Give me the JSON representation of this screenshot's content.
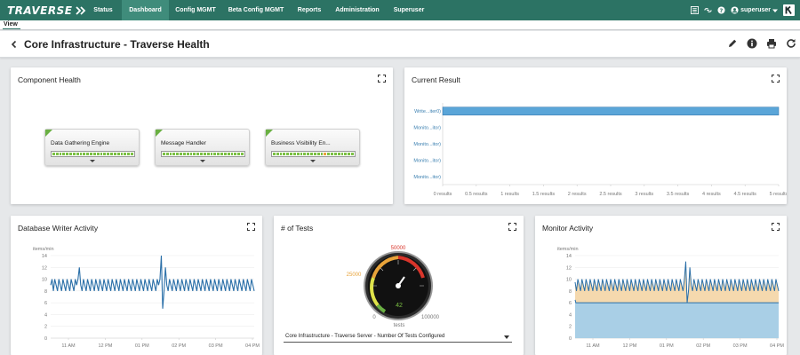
{
  "nav": {
    "brand": "TRAVERSE",
    "tabs": [
      "Status",
      "Dashboard",
      "Config MGMT",
      "Beta Config MGMT",
      "Reports",
      "Administration",
      "Superuser"
    ],
    "active_tab": "Dashboard",
    "user": "superuser"
  },
  "view_label": "View",
  "page": {
    "title": "Core Infrastructure - Traverse Health"
  },
  "component_health": {
    "title": "Component Health",
    "components": [
      {
        "name": "Data Gathering Engine",
        "health": "green"
      },
      {
        "name": "Message Handler",
        "health": "green"
      },
      {
        "name": "Business Visibility En...",
        "health": "green-with-warning"
      }
    ]
  },
  "current_result": {
    "title": "Current Result",
    "rows": [
      "Write...iter0)",
      "Monito...itor)",
      "Monito...itor)",
      "Monito...itor)",
      "Monito...itor)"
    ],
    "x_ticks": [
      "0 results",
      "0.5 results",
      "1 results",
      "1.5 results",
      "2 results",
      "2.5 results",
      "3 results",
      "3.5 results",
      "4 results",
      "4.5 results",
      "5 results"
    ]
  },
  "db_writer": {
    "title": "Database Writer Activity",
    "unit": "items/min"
  },
  "num_tests": {
    "title": "# of Tests",
    "gauge_max": "50000",
    "gauge_mid": "25000",
    "gauge_min": "0",
    "gauge_top": "100000",
    "value": "42",
    "unit": "tests",
    "selector": "Core Infrastructure - Traverse Server - Number Of Tests Configured"
  },
  "monitor_activity": {
    "title": "Monitor Activity",
    "unit": "items/min"
  },
  "chart_data": [
    {
      "type": "bar",
      "title": "Current Result",
      "categories": [
        "Write...iter0)",
        "Monito...itor)",
        "Monito...itor)",
        "Monito...itor)",
        "Monito...itor)"
      ],
      "values": [
        5,
        0,
        0,
        0,
        0
      ],
      "xlim": [
        0,
        5
      ],
      "orientation": "horizontal",
      "color": "#5aa5d8"
    },
    {
      "type": "line",
      "title": "Database Writer Activity",
      "ylabel": "items/min",
      "ylim": [
        0,
        14
      ],
      "yticks": [
        "0",
        "2",
        "4",
        "6",
        "8",
        "10",
        "12",
        "14"
      ],
      "xticks": [
        "11 AM",
        "12 PM",
        "01 PM",
        "02 PM",
        "03 PM",
        "04 PM"
      ],
      "series": [
        {
          "values": [
            9,
            10,
            8,
            10,
            9,
            8,
            10,
            9,
            8,
            10,
            9,
            8,
            10,
            9,
            8,
            10,
            9,
            8,
            10,
            9,
            10,
            12,
            9,
            8,
            10,
            9,
            8,
            10,
            9,
            8,
            10,
            9,
            8,
            10,
            9,
            8,
            10,
            9,
            8,
            10,
            9,
            8,
            10,
            9,
            8,
            10,
            9,
            8,
            10,
            9,
            8,
            10,
            9,
            8,
            10,
            9,
            8,
            10,
            9,
            8,
            10,
            9,
            8,
            10,
            9,
            8,
            10,
            9,
            8,
            10,
            9,
            8,
            10,
            9,
            8,
            10,
            9,
            8,
            10,
            9,
            10,
            14,
            5,
            8,
            12,
            9,
            8,
            10,
            9,
            8,
            10,
            9,
            8,
            10,
            9,
            8,
            10,
            9,
            8,
            10,
            9,
            8,
            10,
            9,
            8,
            10,
            9,
            8,
            10,
            9,
            8,
            10,
            9,
            8,
            10,
            9,
            8,
            10,
            9,
            8,
            10,
            9,
            8,
            10,
            9,
            8,
            10,
            9,
            8,
            10,
            9,
            8,
            10,
            9,
            8,
            10,
            9,
            8,
            10,
            9,
            8,
            10,
            9,
            8,
            10,
            9,
            8,
            10,
            9,
            8
          ]
        }
      ],
      "color": "#2a6fa8"
    },
    {
      "type": "area",
      "title": "Monitor Activity",
      "ylabel": "items/min",
      "ylim": [
        0,
        14
      ],
      "yticks": [
        "0",
        "2",
        "4",
        "6",
        "8",
        "10",
        "12",
        "14"
      ],
      "xticks": [
        "11 AM",
        "12 PM",
        "01 PM",
        "02 PM",
        "03 PM",
        "04 PM"
      ],
      "series": [
        {
          "values": [
            6.5,
            6,
            6,
            6,
            6,
            6,
            6,
            6,
            6,
            6,
            6,
            6,
            6,
            6,
            6,
            6,
            6,
            6,
            6,
            6,
            6,
            6,
            6,
            6,
            6,
            6,
            6,
            6,
            6,
            6,
            6,
            6,
            6,
            6,
            6,
            6,
            6,
            6,
            6,
            6,
            6,
            6,
            6,
            6,
            6,
            6,
            6,
            6,
            6,
            6,
            6,
            6,
            6,
            6,
            6,
            6,
            6,
            6,
            6,
            6,
            6,
            6,
            6,
            6,
            6,
            6,
            6,
            6,
            6,
            6,
            6,
            6,
            6,
            6,
            6,
            6,
            6,
            6,
            6,
            6,
            6,
            6,
            6,
            6,
            6,
            6,
            6,
            6,
            6,
            6,
            6,
            6,
            6,
            6,
            6,
            6,
            6,
            6,
            6,
            6,
            6,
            6,
            6,
            6,
            6,
            6,
            6,
            6,
            6,
            6,
            6,
            6,
            6,
            6,
            6,
            6,
            6,
            6,
            6,
            6,
            6,
            6,
            6,
            6,
            6,
            6,
            6,
            6,
            6,
            6,
            6,
            6,
            6,
            6,
            6,
            6,
            6,
            6,
            6,
            6,
            6,
            6,
            6,
            6,
            6,
            6,
            6,
            6,
            6,
            6,
            6,
            6,
            6,
            6,
            6,
            6,
            6,
            6,
            6,
            6,
            6,
            6,
            6,
            6,
            6,
            6,
            6,
            6,
            6,
            6,
            6,
            6,
            6,
            6,
            6,
            6,
            6,
            6,
            6,
            6,
            6,
            6,
            6,
            6,
            6,
            6,
            6,
            6,
            6,
            6,
            6,
            6,
            6,
            6,
            6,
            6,
            6,
            6,
            6,
            6,
            6,
            6,
            6,
            6,
            6,
            6,
            6,
            6,
            6,
            6,
            6,
            6,
            6,
            6,
            6,
            6,
            6,
            6,
            6,
            6,
            6,
            6,
            6,
            6,
            6,
            6,
            6,
            6,
            6,
            6,
            6,
            6,
            6,
            6,
            6,
            6,
            6,
            6,
            6,
            6,
            6,
            6,
            6,
            6,
            6,
            6,
            6,
            6,
            6,
            6,
            6,
            6,
            6,
            6,
            6,
            6,
            6,
            6,
            6,
            6,
            6,
            6,
            6,
            6,
            6,
            6
          ]
        },
        {
          "values": [
            9.5,
            8,
            10,
            9,
            8,
            10,
            9,
            8,
            10,
            9,
            8,
            10,
            9,
            8,
            10,
            9,
            8,
            10,
            9,
            8,
            10,
            9,
            8,
            10,
            9,
            8,
            10,
            9,
            8,
            10,
            9,
            8,
            10,
            9,
            8,
            10,
            9,
            8,
            10,
            9,
            8,
            10,
            9,
            8,
            10,
            9,
            8,
            10,
            9,
            8,
            10,
            9,
            8,
            10,
            9,
            8,
            10,
            9,
            8,
            10,
            9,
            8,
            10,
            9,
            8,
            10,
            9,
            8,
            10,
            9,
            8,
            10,
            9,
            8,
            10,
            9,
            8,
            10,
            9,
            8,
            10,
            13,
            6,
            8,
            12,
            9,
            8,
            10,
            9,
            8,
            10,
            9,
            8,
            10,
            9,
            8,
            10,
            9,
            8,
            10,
            9,
            8,
            10,
            9,
            8,
            10,
            9,
            8,
            10,
            9,
            8,
            10,
            9,
            8,
            10,
            9,
            8,
            10,
            9,
            8,
            10,
            9,
            8,
            10,
            9,
            8,
            10,
            9,
            8,
            10,
            9,
            8,
            10,
            9,
            8,
            10,
            9,
            8,
            10,
            9,
            8,
            10,
            9,
            8,
            10,
            9,
            8,
            10,
            9,
            8
          ]
        }
      ],
      "colors": [
        "#a9cfe6",
        "#f3d2a0"
      ],
      "line_color": "#2a6fa8"
    }
  ]
}
